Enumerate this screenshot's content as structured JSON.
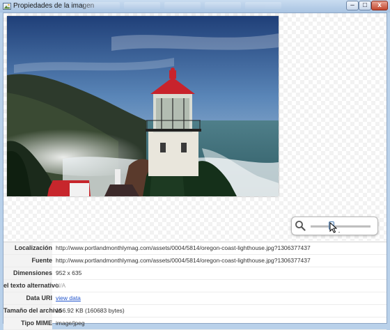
{
  "window": {
    "title": "Propiedades de la imagen",
    "buttons": {
      "minimize": "–",
      "maximize": "□",
      "close": "x"
    }
  },
  "image": {
    "alt": "Oregon coast lighthouse"
  },
  "zoom": {
    "level": 0.35,
    "icon": "magnifier-icon"
  },
  "properties": [
    {
      "label": "Localización",
      "value": "http://www.portlandmonthlymag.com/assets/0004/5814/oregon-coast-lighthouse.jpg?1306377437"
    },
    {
      "label": "Fuente",
      "value": "http://www.portlandmonthlymag.com/assets/0004/5814/oregon-coast-lighthouse.jpg?1306377437"
    },
    {
      "label": "Dimensiones",
      "value": "952 x 635"
    },
    {
      "label": "el texto alternativo",
      "value": "N/A"
    },
    {
      "label": "Data URI",
      "value": "view data"
    },
    {
      "label": "Tamaño del archivo",
      "value": "156.92 KB (160683 bytes)"
    },
    {
      "label": "Tipo MIME",
      "value": "image/jpeg"
    }
  ],
  "colors": {
    "link": "#2255cc",
    "label_bg": "#f3f3f3",
    "frame": "#b9d1ea"
  }
}
